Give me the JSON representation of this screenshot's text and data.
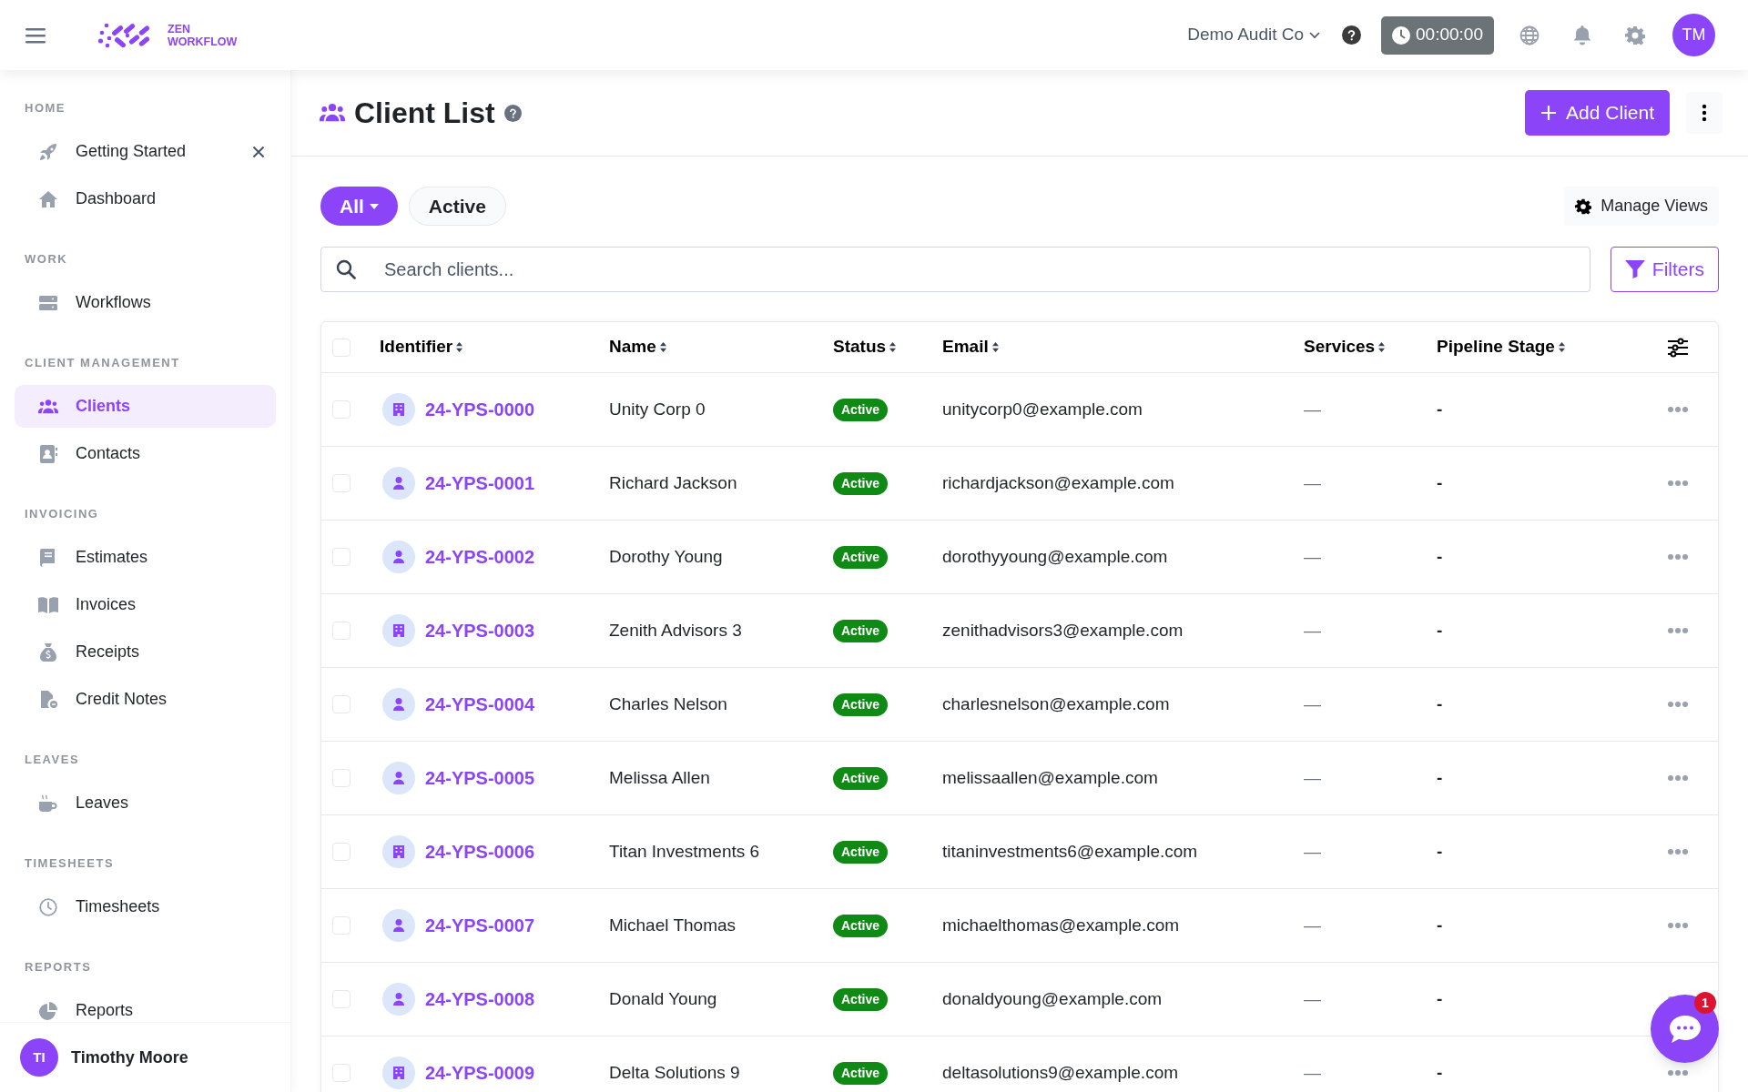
{
  "topbar": {
    "logo_text": [
      "ZEN",
      "WORKFLOW"
    ],
    "organization": "Demo Audit Co",
    "timer": "00:00:00",
    "avatar": "TM"
  },
  "sidebar": {
    "sections": [
      {
        "title": "HOME",
        "items": [
          {
            "label": "Getting Started",
            "selected": false,
            "closable": true
          },
          {
            "label": "Dashboard",
            "selected": false,
            "closable": false
          }
        ]
      },
      {
        "title": "WORK",
        "items": [
          {
            "label": "Workflows",
            "selected": false,
            "closable": false
          }
        ]
      },
      {
        "title": "CLIENT MANAGEMENT",
        "items": [
          {
            "label": "Clients",
            "selected": true,
            "closable": false
          },
          {
            "label": "Contacts",
            "selected": false,
            "closable": false
          }
        ]
      },
      {
        "title": "INVOICING",
        "items": [
          {
            "label": "Estimates",
            "selected": false,
            "closable": false
          },
          {
            "label": "Invoices",
            "selected": false,
            "closable": false
          },
          {
            "label": "Receipts",
            "selected": false,
            "closable": false
          },
          {
            "label": "Credit Notes",
            "selected": false,
            "closable": false
          }
        ]
      },
      {
        "title": "LEAVES",
        "items": [
          {
            "label": "Leaves",
            "selected": false,
            "closable": false
          }
        ]
      },
      {
        "title": "TIMESHEETS",
        "items": [
          {
            "label": "Timesheets",
            "selected": false,
            "closable": false
          }
        ]
      },
      {
        "title": "REPORTS",
        "items": [
          {
            "label": "Reports",
            "selected": false,
            "closable": false
          }
        ]
      }
    ],
    "user": {
      "initials": "TI",
      "name": "Timothy Moore"
    }
  },
  "page": {
    "title": "Client List",
    "add_button": "Add Client"
  },
  "views": [
    {
      "label": "All",
      "selected": true,
      "dropdown": true
    },
    {
      "label": "Active",
      "selected": false,
      "dropdown": false
    }
  ],
  "manage_views": "Manage Views",
  "search": {
    "placeholder": "Search clients..."
  },
  "filters": "Filters",
  "table": {
    "select_all_checked": false,
    "columns": [
      "Identifier",
      "Name",
      "Status",
      "Email",
      "Services",
      "Pipeline Stage"
    ],
    "rows": [
      {
        "checked": false,
        "kind": "company",
        "identifier": "24-YPS-0000",
        "name": "Unity Corp 0",
        "status": "Active",
        "email": "unitycorp0@example.com",
        "services": "—",
        "pipeline_stage": "-"
      },
      {
        "checked": false,
        "kind": "person",
        "identifier": "24-YPS-0001",
        "name": "Richard Jackson",
        "status": "Active",
        "email": "richardjackson@example.com",
        "services": "—",
        "pipeline_stage": "-"
      },
      {
        "checked": false,
        "kind": "person",
        "identifier": "24-YPS-0002",
        "name": "Dorothy Young",
        "status": "Active",
        "email": "dorothyyoung@example.com",
        "services": "—",
        "pipeline_stage": "-"
      },
      {
        "checked": false,
        "kind": "company",
        "identifier": "24-YPS-0003",
        "name": "Zenith Advisors 3",
        "status": "Active",
        "email": "zenithadvisors3@example.com",
        "services": "—",
        "pipeline_stage": "-"
      },
      {
        "checked": false,
        "kind": "person",
        "identifier": "24-YPS-0004",
        "name": "Charles Nelson",
        "status": "Active",
        "email": "charlesnelson@example.com",
        "services": "—",
        "pipeline_stage": "-"
      },
      {
        "checked": false,
        "kind": "person",
        "identifier": "24-YPS-0005",
        "name": "Melissa Allen",
        "status": "Active",
        "email": "melissaallen@example.com",
        "services": "—",
        "pipeline_stage": "-"
      },
      {
        "checked": false,
        "kind": "company",
        "identifier": "24-YPS-0006",
        "name": "Titan Investments 6",
        "status": "Active",
        "email": "titaninvestments6@example.com",
        "services": "—",
        "pipeline_stage": "-"
      },
      {
        "checked": false,
        "kind": "person",
        "identifier": "24-YPS-0007",
        "name": "Michael Thomas",
        "status": "Active",
        "email": "michaelthomas@example.com",
        "services": "—",
        "pipeline_stage": "-"
      },
      {
        "checked": false,
        "kind": "person",
        "identifier": "24-YPS-0008",
        "name": "Donald Young",
        "status": "Active",
        "email": "donaldyoung@example.com",
        "services": "—",
        "pipeline_stage": "-"
      },
      {
        "checked": false,
        "kind": "company",
        "identifier": "24-YPS-0009",
        "name": "Delta Solutions 9",
        "status": "Active",
        "email": "deltasolutions9@example.com",
        "services": "—",
        "pipeline_stage": "-"
      }
    ]
  },
  "chat": {
    "badge": "1"
  }
}
